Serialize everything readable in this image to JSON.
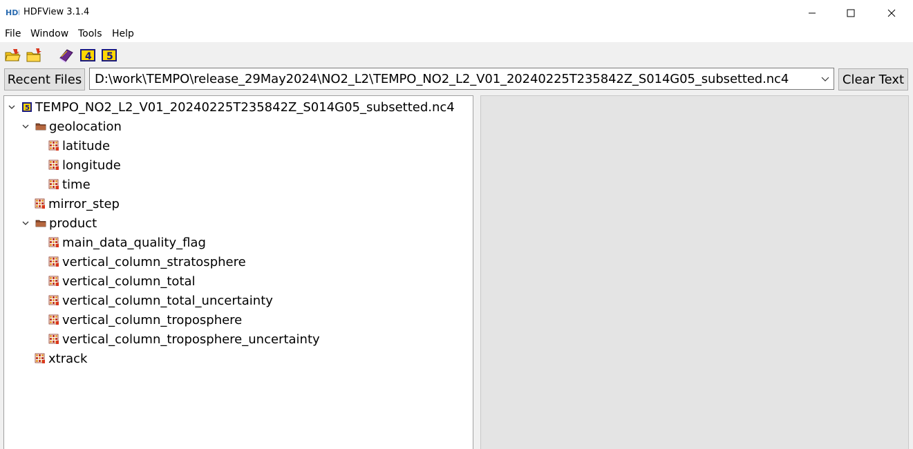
{
  "window": {
    "title": "HDFView 3.1.4",
    "logo_text": "HDF",
    "controls": {
      "minimize": "minimize-icon",
      "maximize": "maximize-icon",
      "close": "close-icon"
    }
  },
  "menu": [
    "File",
    "Window",
    "Tools",
    "Help"
  ],
  "toolbar": {
    "icons": [
      "open-file-icon",
      "open-folder-icon",
      "help-book-icon",
      "hdf4-library-icon",
      "hdf5-library-icon"
    ],
    "hdf4_label": "4",
    "hdf5_label": "5"
  },
  "recent": {
    "button_label": "Recent Files",
    "path": "D:\\work\\TEMPO\\release_29May2024\\NO2_L2\\TEMPO_NO2_L2_V01_20240225T235842Z_S014G05_subsetted.nc4",
    "clear_label": "Clear Text"
  },
  "tree": {
    "root": "TEMPO_NO2_L2_V01_20240225T235842Z_S014G05_subsetted.nc4",
    "nodes": [
      {
        "label": "geolocation",
        "type": "group",
        "expanded": true
      },
      {
        "label": "latitude",
        "type": "dataset"
      },
      {
        "label": "longitude",
        "type": "dataset"
      },
      {
        "label": "time",
        "type": "dataset"
      },
      {
        "label": "mirror_step",
        "type": "dataset"
      },
      {
        "label": "product",
        "type": "group",
        "expanded": true
      },
      {
        "label": "main_data_quality_flag",
        "type": "dataset"
      },
      {
        "label": "vertical_column_stratosphere",
        "type": "dataset"
      },
      {
        "label": "vertical_column_total",
        "type": "dataset"
      },
      {
        "label": "vertical_column_total_uncertainty",
        "type": "dataset"
      },
      {
        "label": "vertical_column_troposphere",
        "type": "dataset"
      },
      {
        "label": "vertical_column_troposphere_uncertainty",
        "type": "dataset"
      },
      {
        "label": "xtrack",
        "type": "dataset"
      }
    ]
  },
  "colors": {
    "titlebar": "#ffffff",
    "chrome": "#f0f0f0",
    "right_panel": "#e4e4e4",
    "folder": "#8b4a2b",
    "dataset_red": "#c0392b",
    "hdf_yellow": "#ffd700"
  }
}
